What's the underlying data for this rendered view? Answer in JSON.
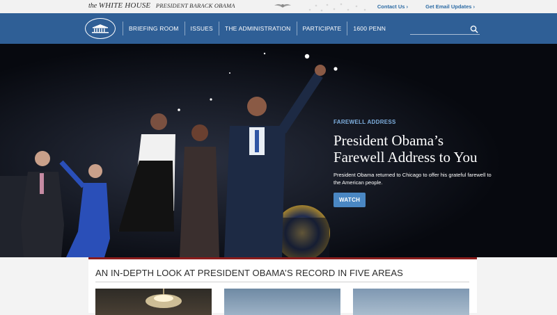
{
  "topbar": {
    "brand_prefix": "the",
    "brand_name": "WHITE HOUSE",
    "brand_president": "PRESIDENT BARACK OBAMA",
    "links": [
      "Contact Us ›",
      "Get Email Updates ›"
    ]
  },
  "nav": {
    "items": [
      "BRIEFING ROOM",
      "ISSUES",
      "THE ADMINISTRATION",
      "PARTICIPATE",
      "1600 PENN"
    ],
    "search_value": "",
    "search_placeholder": ""
  },
  "hero": {
    "eyebrow": "FAREWELL ADDRESS",
    "headline_line1": "President Obama’s",
    "headline_line2": "Farewell Address to You",
    "subhead": "President Obama returned to Chicago to offer his grateful farewell to the American people.",
    "button": "WATCH"
  },
  "section": {
    "title": "AN IN-DEPTH LOOK AT PRESIDENT OBAMA’S RECORD IN FIVE AREAS"
  },
  "colors": {
    "nav_bg": "#2f5f96",
    "accent_blue": "#4a87c3",
    "eyebrow_blue": "#7fb0e0",
    "section_rule_red": "#8b1c1c"
  }
}
